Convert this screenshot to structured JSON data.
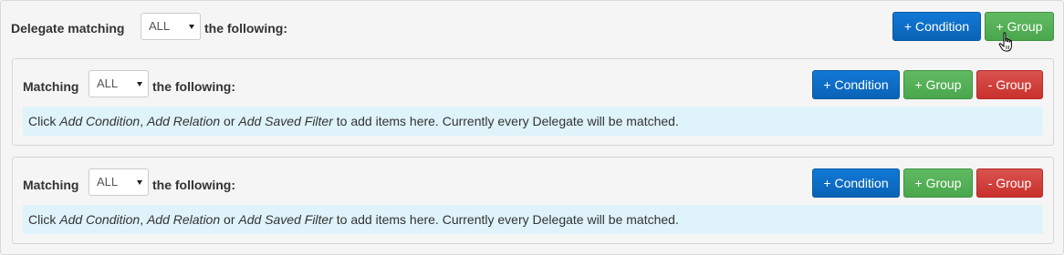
{
  "root": {
    "label_prefix": "Delegate matching",
    "match_value": "ALL",
    "label_suffix": "the following:",
    "add_condition_label": "+ Condition",
    "add_group_label": "+ Group"
  },
  "groups": [
    {
      "label_prefix": "Matching",
      "match_value": "ALL",
      "label_suffix": "the following:",
      "add_condition_label": "+ Condition",
      "add_group_label": "+ Group",
      "remove_group_label": "- Group",
      "info": {
        "text_1": "Click ",
        "link_1": "Add Condition",
        "text_2": ", ",
        "link_2": "Add Relation",
        "text_3": " or ",
        "link_3": "Add Saved Filter",
        "text_4": " to add items here. Currently every Delegate will be matched."
      }
    },
    {
      "label_prefix": "Matching",
      "match_value": "ALL",
      "label_suffix": "the following:",
      "add_condition_label": "+ Condition",
      "add_group_label": "+ Group",
      "remove_group_label": "- Group",
      "info": {
        "text_1": "Click ",
        "link_1": "Add Condition",
        "text_2": ", ",
        "link_2": "Add Relation",
        "text_3": " or ",
        "link_3": "Add Saved Filter",
        "text_4": " to add items here. Currently every Delegate will be matched."
      }
    }
  ],
  "colors": {
    "primary": "#0a63b6",
    "success": "#4aa74c",
    "danger": "#d9534f",
    "info_bg": "#dff3fa",
    "panel_bg": "#f5f5f5"
  },
  "icons": {
    "cursor": "hand-pointer-icon"
  }
}
